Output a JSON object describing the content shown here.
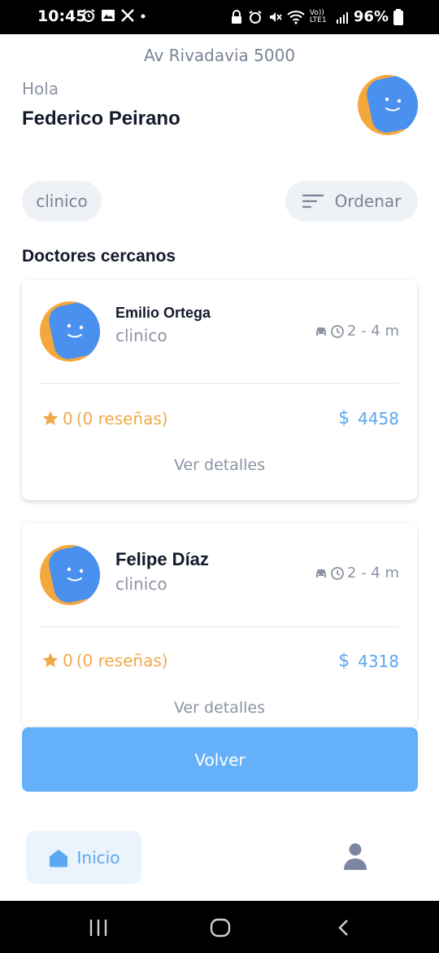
{
  "status_bar": {
    "time": "10:45",
    "battery": "96%",
    "network": "Vo)) LTE1"
  },
  "header": {
    "address": "Av Rivadavia 5000",
    "greeting": "Hola",
    "user_name": "Federico Peirano"
  },
  "filters": {
    "specialty_chip": "clinico",
    "sort_label": "Ordenar"
  },
  "section_title": "Doctores cercanos",
  "doctors": [
    {
      "name": "Emilio Ortega",
      "specialty": "clinico",
      "eta": "2 - 4 m",
      "rating": "0",
      "reviews": "(0 reseñas)",
      "currency": "$",
      "price": "4458",
      "details_label": "Ver detalles"
    },
    {
      "name": "Felipe Díaz",
      "specialty": "clinico",
      "eta": "2 - 4 m",
      "rating": "0",
      "reviews": "(0 reseñas)",
      "currency": "$",
      "price": "4318",
      "details_label": "Ver detalles"
    }
  ],
  "back_button": "Volver",
  "bottom_nav": {
    "home_label": "Inicio"
  },
  "colors": {
    "accent": "#64b1fa",
    "star": "#f0a94a",
    "price": "#5ba7f0",
    "avatar_face": "#4a90ef",
    "avatar_bg": "#f4a83c"
  },
  "icons": [
    "alarm-icon",
    "image-icon",
    "x-logo-icon",
    "car-icon",
    "clock-icon",
    "star-icon",
    "sort-icon",
    "home-icon",
    "person-icon",
    "wifi-icon",
    "signal-icon"
  ]
}
